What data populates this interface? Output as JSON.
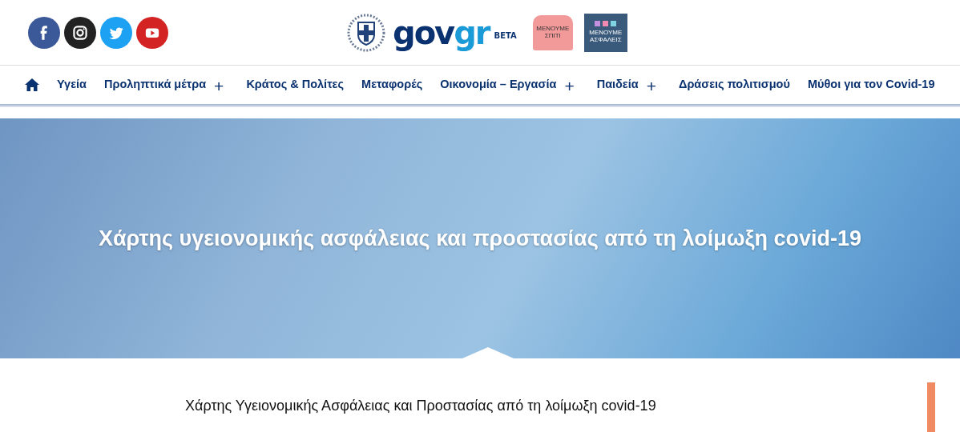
{
  "social": [
    {
      "kind": "facebook"
    },
    {
      "kind": "instagram"
    },
    {
      "kind": "twitter"
    },
    {
      "kind": "youtube"
    }
  ],
  "logo": {
    "gov": "gov",
    "gr": "gr",
    "badge": "BETA"
  },
  "campaigns": [
    {
      "kind": "house",
      "lines": [
        "ΜΕΝΟΥΜΕ",
        "ΣΠΙΤΙ"
      ]
    },
    {
      "kind": "tiles",
      "lines": [
        "ΜΕΝΟΥΜΕ",
        "ΑΣΦΑΛΕΙΣ"
      ]
    }
  ],
  "nav": [
    {
      "label": "Υγεία",
      "expandable": false
    },
    {
      "label": "Προληπτικά μέτρα",
      "expandable": true
    },
    {
      "label": "Κράτος & Πολίτες",
      "expandable": false
    },
    {
      "label": "Μεταφορές",
      "expandable": false
    },
    {
      "label": "Οικονομία – Εργασία",
      "expandable": true
    },
    {
      "label": "Παιδεία",
      "expandable": true
    },
    {
      "label": "Δράσεις πολιτισμού",
      "expandable": false
    },
    {
      "label": "Μύθοι για τον Covid-19",
      "expandable": false
    }
  ],
  "nav_expand_symbol": "+",
  "hero": {
    "title": "Χάρτης υγειονομικής ασφάλειας και προστασίας από τη λοίμωξη covid-19"
  },
  "content": {
    "heading": "Χάρτης Υγειονομικής Ασφάλειας και Προστασίας από τη λοίμωξη covid-19"
  }
}
